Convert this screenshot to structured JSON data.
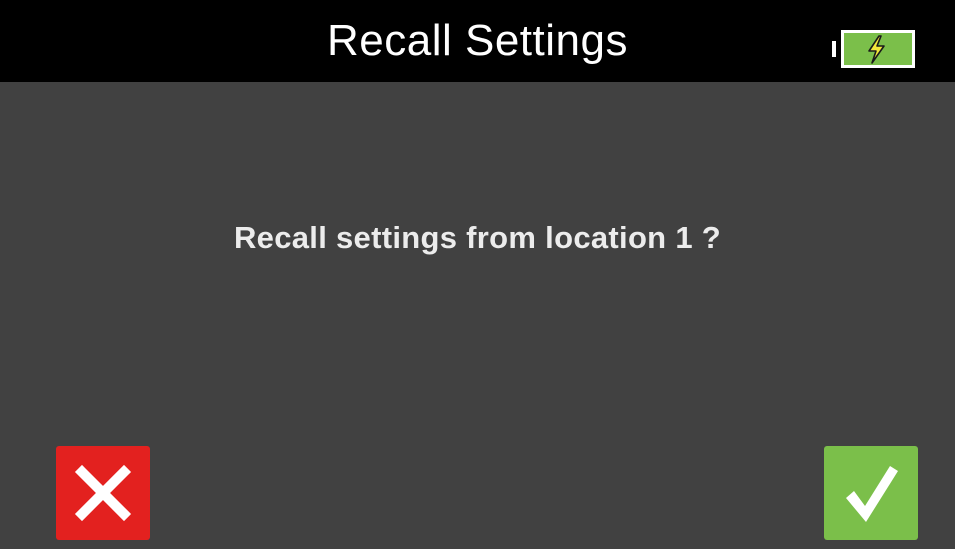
{
  "header": {
    "title": "Recall Settings",
    "battery_icon": "battery-charging-icon"
  },
  "dialog": {
    "message": "Recall settings from location 1 ?"
  },
  "actions": {
    "cancel_icon": "cross-icon",
    "confirm_icon": "checkmark-icon"
  },
  "colors": {
    "background": "#414141",
    "header": "#000000",
    "cancel": "#e3211f",
    "confirm": "#7bbf4a",
    "battery": "#7bbf4a"
  }
}
